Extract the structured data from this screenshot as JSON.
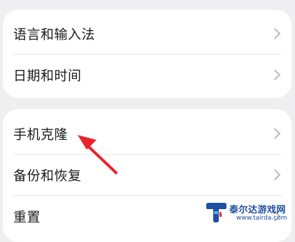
{
  "settings_group_1": {
    "items": [
      {
        "label": "语言和输入法"
      },
      {
        "label": "日期和时间"
      }
    ]
  },
  "settings_group_2": {
    "items": [
      {
        "label": "手机克隆"
      },
      {
        "label": "备份和恢复"
      },
      {
        "label": "重置"
      }
    ]
  },
  "annotation": {
    "arrow_color": "#e8232b"
  },
  "watermark": {
    "title": "泰尔达游戏网",
    "url": "www.tairda.com",
    "color": "#1e4fa3"
  }
}
